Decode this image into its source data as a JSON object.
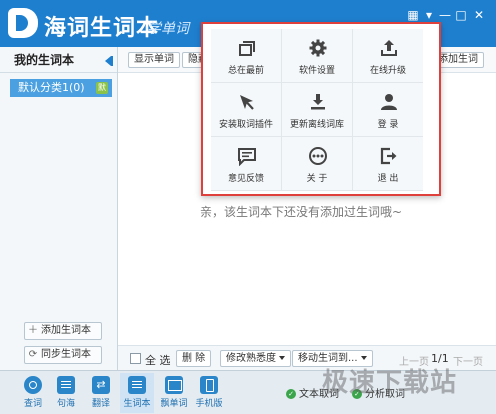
{
  "titlebar": {
    "app_title": "海词生词本",
    "slogan": "学单词",
    "controls": [
      "▦",
      "▾",
      "—",
      "□",
      "✕"
    ]
  },
  "sidebar": {
    "title": "我的生词本",
    "category": "默认分类1(0)",
    "category_badge": "默",
    "add_book_label": "添加生词本",
    "sync_book_label": "同步生词本"
  },
  "toolbar": {
    "show_words": "显示单词",
    "hide_words": "隐藏翻",
    "add_word": "添加生词"
  },
  "main": {
    "empty_message": "亲，该生词本下还没有添加过生词哦~"
  },
  "bottombar": {
    "select_all": "全 选",
    "delete": "删 除",
    "change_familiarity": "修改熟悉度",
    "move_to": "移动生词到...",
    "prev_page": "上一页",
    "page_indicator": "1/1",
    "next_page": "下一页"
  },
  "footer": {
    "nav": [
      {
        "label": "查词",
        "icon": "listen-icon"
      },
      {
        "label": "句海",
        "icon": "book-icon"
      },
      {
        "label": "翻译",
        "icon": "translate-icon"
      },
      {
        "label": "生词本",
        "icon": "notebook-icon"
      },
      {
        "label": "飘单词",
        "icon": "card-icon"
      },
      {
        "label": "手机版",
        "icon": "phone-icon"
      }
    ],
    "status_text": "文本取词",
    "status_text2": "分析取词",
    "watermark": "极速下载站"
  },
  "menu": {
    "items": [
      {
        "label": "总在最前",
        "icon": "window-stack-icon"
      },
      {
        "label": "软件设置",
        "icon": "gear-icon"
      },
      {
        "label": "在线升级",
        "icon": "upload-icon"
      },
      {
        "label": "安装取词插件",
        "icon": "cursor-icon"
      },
      {
        "label": "更新离线词库",
        "icon": "download-icon"
      },
      {
        "label": "登 录",
        "icon": "user-icon"
      },
      {
        "label": "意见反馈",
        "icon": "chat-icon"
      },
      {
        "label": "关 于",
        "icon": "more-dots-icon"
      },
      {
        "label": "退 出",
        "icon": "exit-icon"
      }
    ]
  },
  "colors": {
    "titlebar": "#1f7fcf",
    "accent": "#4aa0e0",
    "menu_border": "#e0403b"
  }
}
